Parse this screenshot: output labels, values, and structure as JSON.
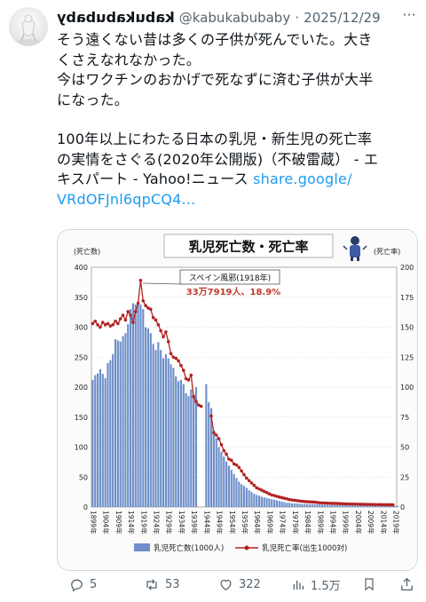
{
  "tweet": {
    "display_name": "kabukabubaby",
    "handle": "@kabukabubaby",
    "separator": "·",
    "date": "2025/12/29",
    "more": "···",
    "lines": [
      "そう遠くない昔は多くの子供が死んでいた。大き",
      "くさえなれなかった。",
      "今はワクチンのおかげで死なずに済む子供が大半",
      "になった。"
    ],
    "article_lines": [
      "100年以上にわたる日本の乳児・新生児の死亡率",
      "の実情をさぐる(2020年公開版)（不破雷蔵） - エ",
      "キスパート - Yahoo!ニュース "
    ],
    "link_part1": "share.google/",
    "link_part2": "VRdOFJnl6qpCQ4..."
  },
  "actions": {
    "replies": "5",
    "reposts": "53",
    "likes": "322",
    "views": "1.5万"
  },
  "chart_data": {
    "type": "bar",
    "title": "乳児死亡数・死亡率",
    "ylabel": "(死亡数)",
    "y2label": "(死亡率)",
    "ylim": [
      0,
      400
    ],
    "y2lim": [
      0,
      200
    ],
    "yticks": [
      "0",
      "50",
      "100",
      "150",
      "200",
      "250",
      "300",
      "350",
      "400"
    ],
    "y2ticks": [
      "0",
      "25",
      "50",
      "75",
      "100",
      "125",
      "150",
      "175",
      "200"
    ],
    "x_start": 1899,
    "x_end": 2019,
    "xtick_labels": [
      "1899年",
      "1904年",
      "1909年",
      "1914年",
      "1919年",
      "1924年",
      "1929年",
      "1934年",
      "1939年",
      "1944年",
      "1949年",
      "1954年",
      "1959年",
      "1964年",
      "1969年",
      "1974年",
      "1979年",
      "1984年",
      "1989年",
      "1994年",
      "1999年",
      "2004年",
      "2009年",
      "2014年",
      "2019年"
    ],
    "missing_years": [
      1944,
      1945,
      1946
    ],
    "annotation_title": "スペイン風邪(1918年)",
    "annotation_value": "33万7919人、18.9%",
    "legend_bar": "乳児死亡数(1000人)",
    "legend_line": "乳児死亡率(出生1000対)",
    "bar_color": "#6f8fc9",
    "line_color": "#b22222",
    "series": [
      {
        "name": "乳児死亡数(1000人)",
        "values": [
          212,
          220,
          223,
          230,
          222,
          215,
          240,
          245,
          255,
          280,
          278,
          276,
          285,
          290,
          305,
          330,
          340,
          338,
          342,
          338,
          330,
          300,
          298,
          290,
          272,
          262,
          275,
          262,
          248,
          255,
          248,
          238,
          232,
          218,
          210,
          212,
          205,
          190,
          185,
          196,
          188,
          200,
          0,
          0,
          0,
          205,
          175,
          165,
          128,
          115,
          100,
          92,
          84,
          76,
          69,
          62,
          55,
          48,
          42,
          38,
          35,
          32,
          28,
          25,
          22,
          20,
          19,
          17,
          16,
          15,
          14,
          13,
          12,
          11,
          10,
          9,
          8,
          7,
          7,
          6,
          6,
          5.8,
          5.5,
          5.2,
          5,
          4.8,
          4.6,
          4.5,
          4.4,
          4.3,
          4.2,
          4,
          3.8,
          3.7,
          3.6,
          3.5,
          3.4,
          3.3,
          3.2,
          3.1,
          3,
          2.9,
          2.8,
          2.7,
          2.7,
          2.6,
          2.5,
          2.4,
          2.3,
          2.3,
          2.2,
          2.1,
          2.1,
          2,
          2,
          1.9,
          1.9,
          1.8,
          1.8,
          1.8,
          1.7,
          1.7
        ]
      },
      {
        "name": "乳児死亡率(出生1000対)",
        "values": [
          153,
          155,
          152,
          150,
          154,
          152,
          153,
          151,
          152,
          155,
          153,
          157,
          160,
          156,
          163,
          160,
          154,
          163,
          170,
          189,
          172,
          168,
          166,
          165,
          158,
          156,
          152,
          147,
          142,
          146,
          138,
          128,
          125,
          124,
          122,
          118,
          114,
          107,
          106,
          110,
          92,
          88,
          85,
          84,
          null,
          null,
          null,
          76,
          62,
          60,
          57,
          52,
          47,
          44,
          40,
          39,
          36,
          35,
          33,
          30,
          27,
          24,
          22,
          20,
          18,
          16,
          15,
          14,
          13,
          12,
          11,
          10,
          9.5,
          8.9,
          8.3,
          7.8,
          7.3,
          6.8,
          6.2,
          5.9,
          5.6,
          5.3,
          5,
          4.8,
          4.6,
          4.4,
          4.3,
          4.2,
          4,
          3.8,
          3.5,
          3.4,
          3.3,
          3.2,
          3.1,
          3,
          3,
          2.9,
          2.8,
          2.7,
          2.6,
          2.6,
          2.5,
          2.5,
          2.4,
          2.4,
          2.3,
          2.3,
          2.2,
          2.2,
          2.1,
          2.1,
          2,
          2,
          2,
          1.9,
          1.9,
          1.9,
          1.9,
          1.8
        ]
      }
    ]
  }
}
